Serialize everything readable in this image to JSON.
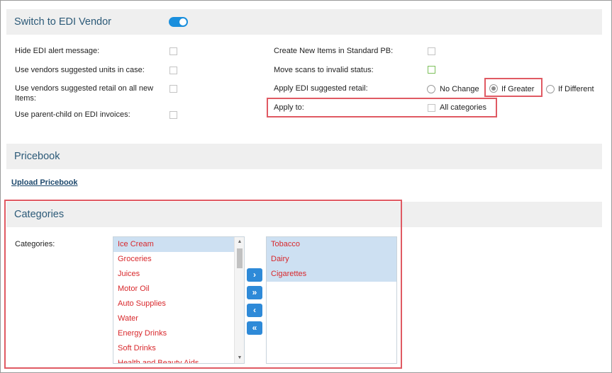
{
  "edi_section": {
    "title": "Switch to EDI Vendor",
    "toggle_on": true,
    "left_options": [
      {
        "label": "Hide EDI alert message:",
        "checked": false
      },
      {
        "label": "Use vendors suggested units in case:",
        "checked": false
      },
      {
        "label": "Use vendors suggested retail on all new Items:",
        "checked": false
      },
      {
        "label": "Use parent-child on EDI invoices:",
        "checked": false
      }
    ],
    "right_options": [
      {
        "label": "Create New Items in Standard PB:",
        "checked": false
      },
      {
        "label": "Move scans to invalid status:",
        "checked": false
      }
    ],
    "apply_retail": {
      "label": "Apply EDI suggested retail:",
      "options": [
        "No Change",
        "If Greater",
        "If Different"
      ],
      "selected": "If Greater"
    },
    "apply_to": {
      "label": "Apply to:",
      "checkbox_label": "All categories",
      "checked": false
    }
  },
  "pricebook_section": {
    "title": "Pricebook",
    "upload_link": "Upload Pricebook"
  },
  "categories_section": {
    "title": "Categories",
    "field_label": "Categories:",
    "available": [
      "Ice Cream",
      "Groceries",
      "Juices",
      "Motor Oil",
      "Auto Supplies",
      "Water",
      "Energy Drinks",
      "Soft Drinks",
      "Health and Beauty Aids"
    ],
    "selected": [
      "Tobacco",
      "Dairy",
      "Cigarettes"
    ],
    "buttons": {
      "move_right": "›",
      "move_all_right": "»",
      "move_left": "‹",
      "move_all_left": "«"
    }
  },
  "colors": {
    "accent": "#1a8fdd",
    "highlight_box": "#e05a63",
    "list_text": "#d8282c",
    "section_header_text": "#2c5a78"
  }
}
